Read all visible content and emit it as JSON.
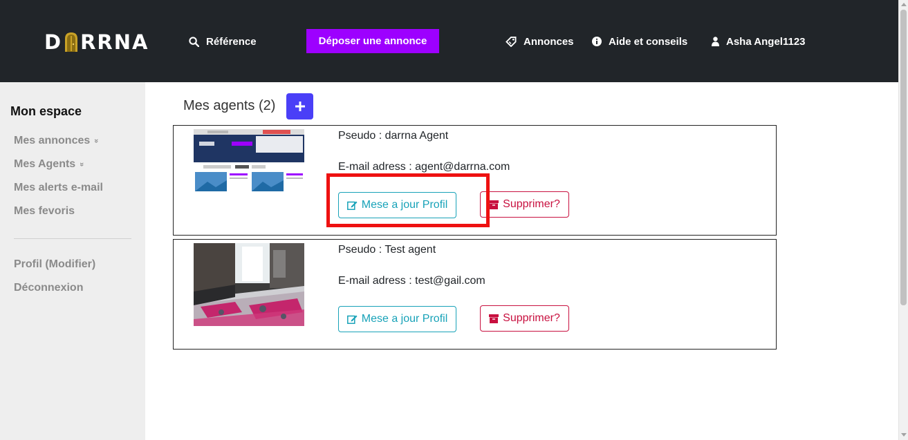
{
  "header": {
    "logo": {
      "left": "D",
      "right": "RRNA"
    },
    "nav": {
      "reference": "Référence",
      "post_ad": "Déposer une annonce",
      "ads": "Annonces",
      "help": "Aide et conseils",
      "user": "Asha Angel1123"
    }
  },
  "sidebar": {
    "title": "Mon espace",
    "items": [
      {
        "label": "Mes annonces",
        "chevron": "»"
      },
      {
        "label": "Mes Agents",
        "chevron": "»"
      },
      {
        "label": "Mes alerts e-mail"
      },
      {
        "label": "Mes fevoris"
      },
      {
        "label": "Profil (Modifier)"
      },
      {
        "label": "Déconnexion"
      }
    ]
  },
  "main": {
    "title": "Mes agents (2)",
    "agents": [
      {
        "pseudo": "Pseudo : darrna Agent",
        "email": "E-mail adress : agent@darrna.com",
        "edit_label": "Mese a jour Profil",
        "delete_label": "Supprimer?"
      },
      {
        "pseudo": "Pseudo : Test agent",
        "email": "E-mail adress : test@gail.com",
        "edit_label": "Mese a jour Profil",
        "delete_label": "Supprimer?"
      }
    ]
  },
  "colors": {
    "header_bg": "#212529",
    "accent_purple": "#9d00ff",
    "add_button": "#4a3ff7",
    "edit_teal": "#17a2b8",
    "delete_red": "#c8103f",
    "highlight": "#ee1111"
  }
}
